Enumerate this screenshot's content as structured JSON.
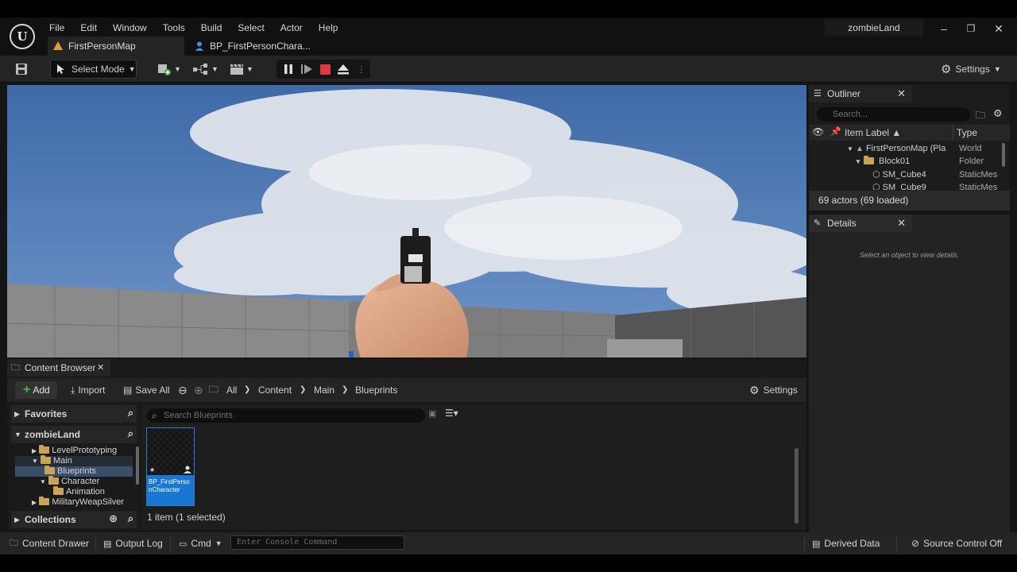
{
  "menu": [
    "File",
    "Edit",
    "Window",
    "Tools",
    "Build",
    "Select",
    "Actor",
    "Help"
  ],
  "project_name": "zombieLand",
  "tabs": [
    {
      "label": "FirstPersonMap",
      "icon": "map-icon"
    },
    {
      "label": "BP_FirstPersonChara...",
      "icon": "character-icon",
      "modified": "•"
    }
  ],
  "toolbar": {
    "select_mode": "Select Mode",
    "settings": "Settings"
  },
  "outliner": {
    "title": "Outliner",
    "search_placeholder": "Search...",
    "col_label": "Item Label ▲",
    "col_type": "Type",
    "rows": [
      {
        "label": "FirstPersonMap (Pla",
        "type": "World"
      },
      {
        "label": "Block01",
        "type": "Folder"
      },
      {
        "label": "SM_Cube4",
        "type": "StaticMes"
      },
      {
        "label": "SM_Cube9",
        "type": "StaticMes"
      }
    ],
    "status": "69 actors (69 loaded)"
  },
  "details": {
    "title": "Details",
    "hint": "Select an object to view details."
  },
  "content_browser": {
    "title": "Content Browser",
    "add": "Add",
    "import": "Import",
    "save_all": "Save All",
    "breadcrumb": [
      "All",
      "Content",
      "Main",
      "Blueprints"
    ],
    "settings": "Settings",
    "favorites": "Favorites",
    "project_root": "zombieLand",
    "collections": "Collections",
    "tree": [
      "LevelPrototyping",
      "Main",
      "Blueprints",
      "Character",
      "Animation",
      "MilitaryWeapSilver"
    ],
    "search_placeholder": "Search Blueprints",
    "asset_label": "BP_FirstPersonCharacter",
    "item_count": "1 item (1 selected)"
  },
  "statusbar": {
    "content_drawer": "Content Drawer",
    "output_log": "Output Log",
    "cmd": "Cmd",
    "console_placeholder": "Enter Console Command",
    "derived_data": "Derived Data",
    "source_control": "Source Control Off"
  }
}
